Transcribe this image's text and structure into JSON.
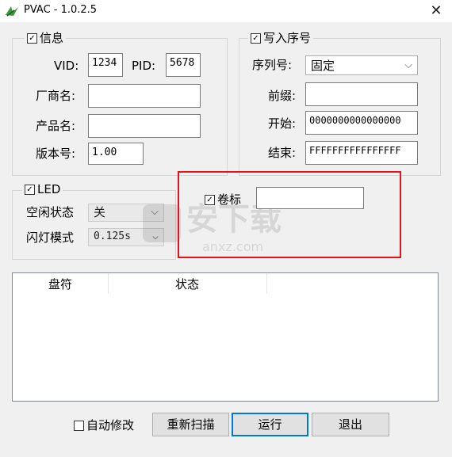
{
  "window": {
    "title": "PVAC - 1.0.2.5",
    "close_symbol": "✕"
  },
  "info_group": {
    "legend": "信息",
    "checked": true,
    "vid_label": "VID:",
    "vid_value": "1234",
    "pid_label": "PID:",
    "pid_value": "5678",
    "vendor_label": "厂商名:",
    "vendor_value": "",
    "product_label": "产品名:",
    "product_value": "",
    "version_label": "版本号:",
    "version_value": "1.00"
  },
  "serial_group": {
    "legend": "写入序号",
    "checked": true,
    "serial_label": "序列号:",
    "serial_mode": "固定",
    "prefix_label": "前缀:",
    "prefix_value": "",
    "start_label": "开始:",
    "start_value": "0000000000000000",
    "end_label": "结束:",
    "end_value": "FFFFFFFFFFFFFFFF"
  },
  "led_group": {
    "legend": "LED",
    "checked": true,
    "idle_label": "空闲状态",
    "idle_value": "关",
    "blink_label": "闪灯模式",
    "blink_value": "0.125s"
  },
  "volume": {
    "label": "卷标",
    "checked": true,
    "value": ""
  },
  "drive_list": {
    "columns": [
      "盘符",
      "状态"
    ],
    "rows": []
  },
  "footer": {
    "auto_modify_label": "自动修改",
    "auto_modify_checked": false,
    "rescan_label": "重新扫描",
    "run_label": "运行",
    "exit_label": "退出"
  },
  "watermark": {
    "text_cn": "安下载",
    "text_en": "anxz.com"
  },
  "colors": {
    "highlight": "#e8101c",
    "accent": "#0078d7"
  }
}
